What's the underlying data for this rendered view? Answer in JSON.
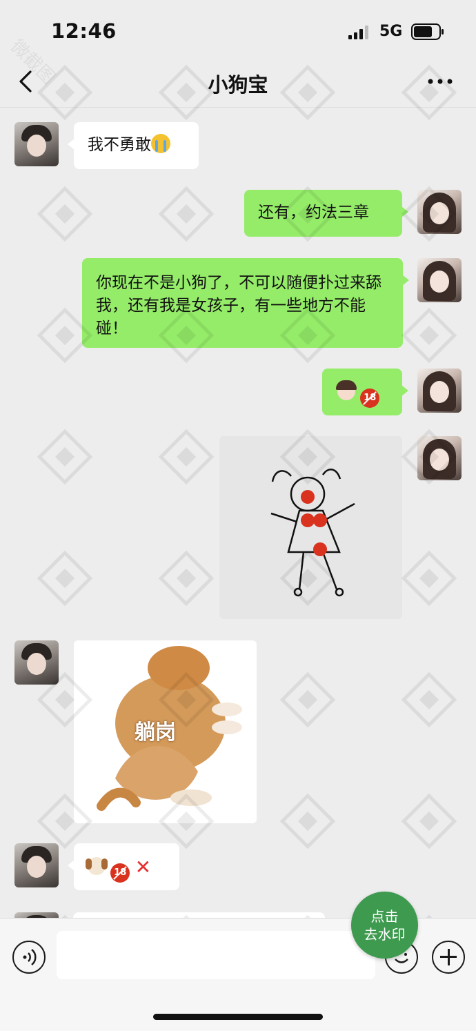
{
  "status_bar": {
    "time": "12:46",
    "network": "5G"
  },
  "header": {
    "title": "小狗宝"
  },
  "messages": [
    {
      "side": "left",
      "type": "text",
      "text": "我不勇敢",
      "emojis": [
        "loudly-crying-face"
      ]
    },
    {
      "side": "right",
      "type": "text",
      "text": "还有，约法三章"
    },
    {
      "side": "right",
      "type": "text",
      "text": "你现在不是小狗了，不可以随便扑过来舔我，还有我是女孩子，有一些地方不能碰！"
    },
    {
      "side": "right",
      "type": "emoji",
      "emojis": [
        "girl-face",
        "no-one-under-eighteen"
      ]
    },
    {
      "side": "right",
      "type": "image",
      "description_icon": "stick-figure-drawing"
    },
    {
      "side": "left",
      "type": "sticker",
      "text": "躺岗"
    },
    {
      "side": "left",
      "type": "emoji",
      "emojis": [
        "dog-face",
        "no-one-under-eighteen",
        "cross-mark"
      ]
    }
  ],
  "watermark_button": {
    "line1": "点击",
    "line2": "去水印"
  },
  "watermark_text": "微截图",
  "colors": {
    "background": "#ededed",
    "sent_bubble": "#95ec69",
    "received_bubble": "#ffffff",
    "watermark_button": "#3d9a4e"
  }
}
